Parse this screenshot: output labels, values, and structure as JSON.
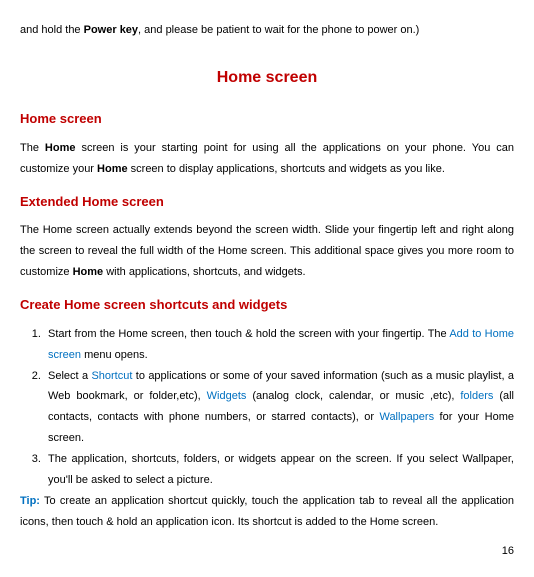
{
  "intro_fragment_1": "and hold the ",
  "intro_bold": "Power key",
  "intro_fragment_2": ", and please be patient to wait for the phone to power on.)",
  "page_title": "Home screen",
  "sections": {
    "home": {
      "heading": "Home screen",
      "p1_a": "The ",
      "p1_b": "Home",
      "p1_c": " screen is your starting point for using all the applications on your phone. You can customize your ",
      "p1_d": "Home",
      "p1_e": " screen to display applications, shortcuts and widgets as you like."
    },
    "extended": {
      "heading": "Extended Home screen",
      "p1_a": "The Home screen actually extends beyond the screen width. Slide your fingertip left and right along the screen to reveal the full width of the Home screen. This additional space gives you more room to customize ",
      "p1_b": "Home",
      "p1_c": " with applications, shortcuts, and widgets."
    },
    "create": {
      "heading": "Create Home screen shortcuts and widgets",
      "li1_a": "Start from the Home screen, then touch & hold the screen with your fingertip. The ",
      "li1_b": "Add to Home screen",
      "li1_c": " menu opens.",
      "li2_a": "Select a ",
      "li2_b": "Shortcut",
      "li2_c": " to applications or some of your saved information (such as a music playlist, a Web bookmark, or folder,etc), ",
      "li2_d": "Widgets",
      "li2_e": " (analog clock, calendar, or music ,etc), ",
      "li2_f": "folders",
      "li2_g": " (all contacts, contacts with phone numbers, or starred contacts), or ",
      "li2_h": "Wallpapers",
      "li2_i": " for your Home screen.",
      "li3": "The application, shortcuts, folders, or widgets appear on the screen. If you select Wallpaper, you'll be asked to select a picture.",
      "tip_label": "Tip:",
      "tip_text": " To create an application shortcut quickly, touch the application tab to reveal all the application icons, then touch & hold an application icon. Its shortcut is added to the Home screen."
    }
  },
  "page_number": "16"
}
